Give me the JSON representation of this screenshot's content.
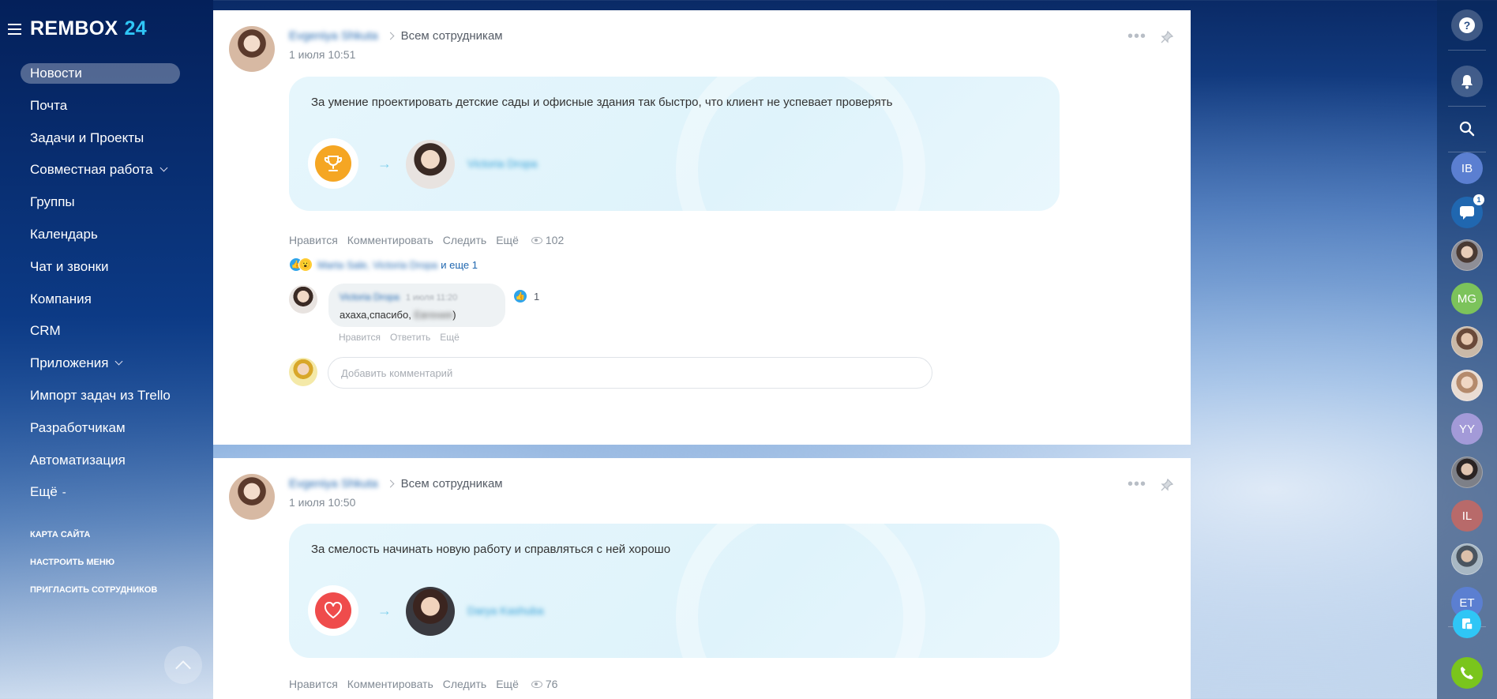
{
  "app": {
    "logo_name": "REMBOX",
    "logo_num": "24"
  },
  "sidebar": {
    "items": [
      {
        "label": "Новости",
        "active": true
      },
      {
        "label": "Почта"
      },
      {
        "label": "Задачи и Проекты"
      },
      {
        "label": "Совместная работа",
        "has_dropdown": true
      },
      {
        "label": "Группы"
      },
      {
        "label": "Календарь"
      },
      {
        "label": "Чат и звонки"
      },
      {
        "label": "Компания"
      },
      {
        "label": "CRM"
      },
      {
        "label": "Приложения",
        "has_dropdown": true
      },
      {
        "label": "Импорт задач из Trello"
      },
      {
        "label": "Разработчикам"
      },
      {
        "label": "Автоматизация"
      },
      {
        "label": "Ещё",
        "suffix": "-"
      }
    ],
    "small_links": [
      "КАРТА САЙТА",
      "НАСТРОИТЬ МЕНЮ",
      "ПРИГЛАСИТЬ СОТРУДНИКОВ"
    ]
  },
  "posts": [
    {
      "author": "Evgeniya Shkuta",
      "audience": "Всем сотрудникам",
      "date": "1 июля 10:51",
      "gratitude_text": "За умение проектировать детские сады и офисные здания так быстро, что клиент не успевает проверять",
      "badge": "trophy-icon",
      "recipient": "Victoria Dropa",
      "actions": {
        "like": "Нравится",
        "comment": "Комментировать",
        "follow": "Следить",
        "more": "Ещё"
      },
      "views": "102",
      "reactions": {
        "names": "Marta Sale, Victoria Dropa",
        "more": "и еще 1"
      },
      "comment": {
        "author": "Victoria Dropa",
        "time": "1 июля 11:20",
        "text_prefix": "ахаха,спасибо,",
        "text_mention": "Евгения",
        "text_suffix": ")",
        "likes": "1",
        "actions": {
          "like": "Нравится",
          "reply": "Ответить",
          "more": "Ещё"
        }
      },
      "add_comment_placeholder": "Добавить комментарий"
    },
    {
      "author": "Evgeniya Shkuta",
      "audience": "Всем сотрудникам",
      "date": "1 июля 10:50",
      "gratitude_text": "За смелость начинать новую работу и справляться с ней хорошо",
      "badge": "heart-icon",
      "recipient": "Darya Kashuba",
      "actions": {
        "like": "Нравится",
        "comment": "Комментировать",
        "follow": "Следить",
        "more": "Ещё"
      },
      "views": "76"
    }
  ],
  "right_panel": {
    "help_icon": "help-icon",
    "notifications_icon": "bell-icon",
    "search_icon": "search-icon",
    "contacts": [
      {
        "initials": "IB",
        "color": "#5b7fd1"
      },
      {
        "type": "chat",
        "counter": "1",
        "color": "#2067b0"
      },
      {
        "type": "photo"
      },
      {
        "initials": "MG",
        "color": "#7cc35b"
      },
      {
        "type": "photo"
      },
      {
        "type": "photo"
      },
      {
        "initials": "YY",
        "color": "#a39ad8"
      },
      {
        "type": "photo"
      },
      {
        "initials": "IL",
        "color": "#b86a6a"
      },
      {
        "type": "photo"
      },
      {
        "initials": "ET",
        "color": "#5b7fd1"
      }
    ],
    "call_button_color": "#7ac51c"
  }
}
